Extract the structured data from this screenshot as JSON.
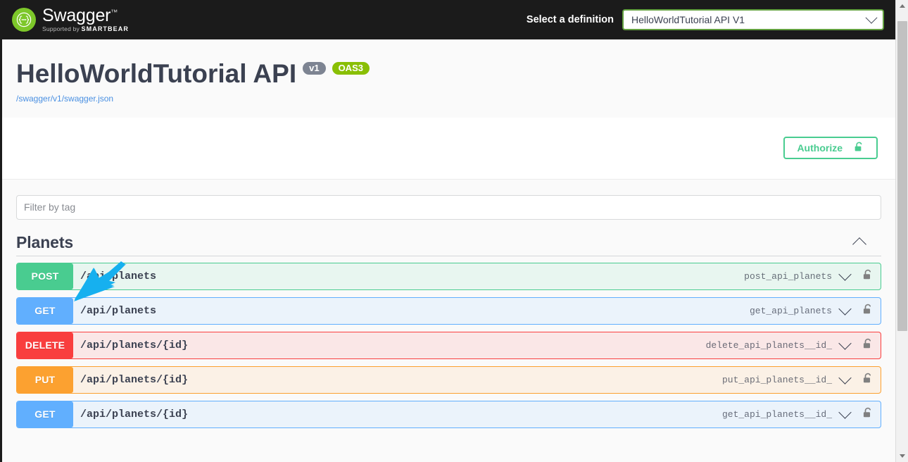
{
  "topbar": {
    "logo_text": "Swagger",
    "logo_tm": "™",
    "logo_supported_prefix": "Supported by",
    "logo_brand": "SMARTBEAR",
    "logo_icon": "swagger-brace-icon",
    "select_label": "Select a definition",
    "selected_definition": "HelloWorldTutorial API V1",
    "select_chevron_icon": "chevron-down-icon",
    "background_color": "#1b1b1b",
    "select_border_color": "#62a03f"
  },
  "info": {
    "title": "HelloWorldTutorial API",
    "version_badge": "v1",
    "spec_badge": "OAS3",
    "url": "/swagger/v1/swagger.json",
    "version_badge_color": "#7d8492",
    "spec_badge_color": "#89bf04",
    "url_color": "#4a90e2"
  },
  "authorize": {
    "label": "Authorize",
    "lock_icon": "unlocked-padlock-icon",
    "color": "#49cc90"
  },
  "filter": {
    "placeholder": "Filter by tag",
    "value": ""
  },
  "tag_section": {
    "name": "Planets",
    "collapse_icon": "chevron-up-icon",
    "expanded": true
  },
  "operations": [
    {
      "method": "POST",
      "path": "/api/planets",
      "operation_id": "post_api_planets",
      "method_class": "m-post",
      "row_class": "row-post",
      "chevron_icon": "chevron-down-icon",
      "lock_icon": "unlocked-padlock-icon",
      "method_color": "#49cc90",
      "row_background": "#e8f6f0"
    },
    {
      "method": "GET",
      "path": "/api/planets",
      "operation_id": "get_api_planets",
      "method_class": "m-get",
      "row_class": "row-get",
      "chevron_icon": "chevron-down-icon",
      "lock_icon": "unlocked-padlock-icon",
      "method_color": "#61affe",
      "row_background": "#ebf3fb"
    },
    {
      "method": "DELETE",
      "path": "/api/planets/{id}",
      "operation_id": "delete_api_planets__id_",
      "method_class": "m-delete",
      "row_class": "row-delete",
      "chevron_icon": "chevron-down-icon",
      "lock_icon": "unlocked-padlock-icon",
      "method_color": "#f93e3e",
      "row_background": "#fae7e7"
    },
    {
      "method": "PUT",
      "path": "/api/planets/{id}",
      "operation_id": "put_api_planets__id_",
      "method_class": "m-put",
      "row_class": "row-put",
      "chevron_icon": "chevron-down-icon",
      "lock_icon": "unlocked-padlock-icon",
      "method_color": "#fca130",
      "row_background": "#fbf1e6"
    },
    {
      "method": "GET",
      "path": "/api/planets/{id}",
      "operation_id": "get_api_planets__id_",
      "method_class": "m-get",
      "row_class": "row-get",
      "chevron_icon": "chevron-down-icon",
      "lock_icon": "unlocked-padlock-icon",
      "method_color": "#61affe",
      "row_background": "#ebf3fb"
    }
  ],
  "annotation": {
    "shape": "arrow-pointing-down-left",
    "color": "#16b0ef"
  },
  "scrollbar": {
    "up_arrow_icon": "scroll-up-arrow-icon",
    "down_arrow_icon": "scroll-down-arrow-icon",
    "thumb_color": "#c1c1c1"
  }
}
